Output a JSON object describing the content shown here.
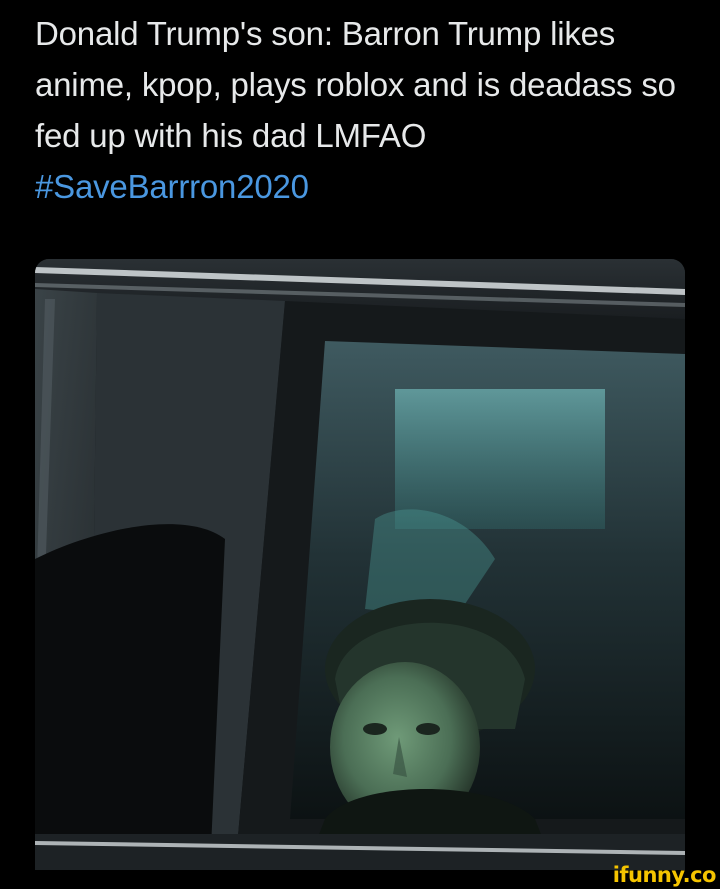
{
  "tweet": {
    "text": "Donald Trump's son: Barron Trump likes anime, kpop, plays roblox and is deadass so fed up with his dad LMFAO ",
    "hashtag": "#SaveBarrron2020"
  },
  "watermark": {
    "text": "ifunny.co",
    "color": "#f5c400"
  },
  "colors": {
    "background": "#000000",
    "text": "#e7e9ea",
    "hashtag": "#4a97e0"
  }
}
